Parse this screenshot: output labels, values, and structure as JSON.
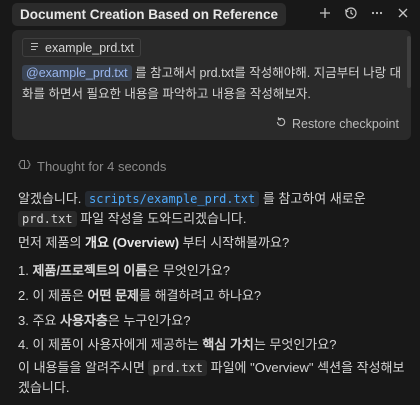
{
  "header": {
    "title": "Document Creation Based on Reference"
  },
  "icons": {
    "add": "plus-icon",
    "history": "history-icon",
    "more": "more-icon",
    "close": "close-icon",
    "file": "file-icon",
    "restore": "restore-icon",
    "thought": "brain-icon"
  },
  "user_message": {
    "file_chip": "example_prd.txt",
    "mention": "@example_prd.txt",
    "text": " 를 참고해서 prd.txt를 작성해야해. 지금부터 나랑 대화를 하면서 필요한 내용을 파악하고 내용을 작성해보자."
  },
  "restore_label": "Restore checkpoint",
  "thought_label": "Thought for 4 seconds",
  "response": {
    "p1_a": "알겠습니다. ",
    "p1_link": "scripts/example_prd.txt",
    "p1_b": " 를 참고하여 새로운 ",
    "p1_code": "prd.txt",
    "p1_c": " 파일 작성을 도와드리겠습니다.",
    "p2_a": "먼저 제품의 ",
    "p2_bold": "개요 (Overview)",
    "p2_b": " 부터 시작해볼까요?",
    "items": [
      {
        "num": "1. ",
        "bold": "제품/프로젝트의 이름",
        "rest": "은 무엇인가요?"
      },
      {
        "num": "2. ",
        "pre": "이 제품은 ",
        "bold": "어떤 문제",
        "rest": "를 해결하려고 하나요?"
      },
      {
        "num": "3. ",
        "pre": "주요 ",
        "bold": "사용자층",
        "rest": "은 누구인가요?"
      },
      {
        "num": "4. ",
        "pre": "이 제품이 사용자에게 제공하는 ",
        "bold": "핵심 가치",
        "rest": "는 무엇인가요?"
      }
    ],
    "p3_a": "이 내용들을 알려주시면 ",
    "p3_code": "prd.txt",
    "p3_b": " 파일에 \"Overview\" 섹션을 작성해보겠습니다."
  },
  "colors": {
    "background": "#181818",
    "card": "#2a2a2a",
    "link": "#4daafc",
    "mention_bg": "#3a4453"
  }
}
